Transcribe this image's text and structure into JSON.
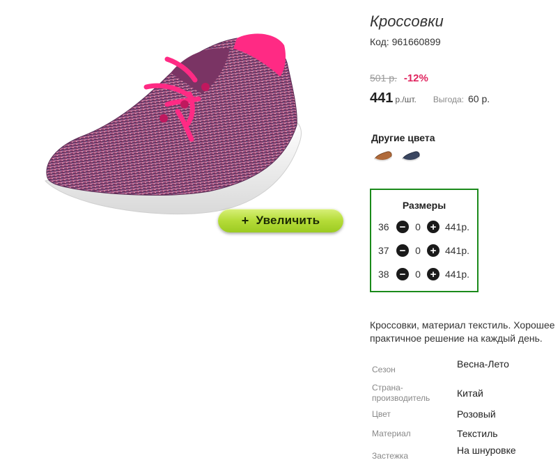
{
  "product": {
    "title": "Кроссовки",
    "code": "Код: 961660899",
    "old_price": "501 р.",
    "discount": "-12%",
    "price": "441",
    "price_unit": "р./шт.",
    "benefit_label": "Выгода:",
    "benefit_value": "60 р."
  },
  "zoom": {
    "plus": "+",
    "label": "Увеличить"
  },
  "other_colors": {
    "title": "Другие цвета",
    "swatches": [
      {
        "name": "brown-shoe",
        "color": "#b06a3a"
      },
      {
        "name": "navy-shoe",
        "color": "#3a4660"
      }
    ]
  },
  "sizes": {
    "title": "Размеры",
    "rows": [
      {
        "size": "36",
        "qty": "0",
        "price": "441р."
      },
      {
        "size": "37",
        "qty": "0",
        "price": "441р."
      },
      {
        "size": "38",
        "qty": "0",
        "price": "441р."
      }
    ],
    "minus": "−",
    "plus": "+"
  },
  "description": "Кроссовки, материал текстиль. Хорошее практичное решение на каждый день.",
  "specs": [
    {
      "label": "Сезон",
      "value": "Весна-Лето"
    },
    {
      "label": "Страна-производитель",
      "value": "Китай"
    },
    {
      "label": "Цвет",
      "value": "Розовый"
    },
    {
      "label": "Материал",
      "value": "Текстиль"
    },
    {
      "label": "Застежка",
      "value": "На шнуровке"
    }
  ],
  "colors": {
    "accent_green": "#1a8a1a",
    "discount_pink": "#e0245e",
    "shoe_pink": "#ff2a84",
    "button_green": "#b5dc38"
  }
}
